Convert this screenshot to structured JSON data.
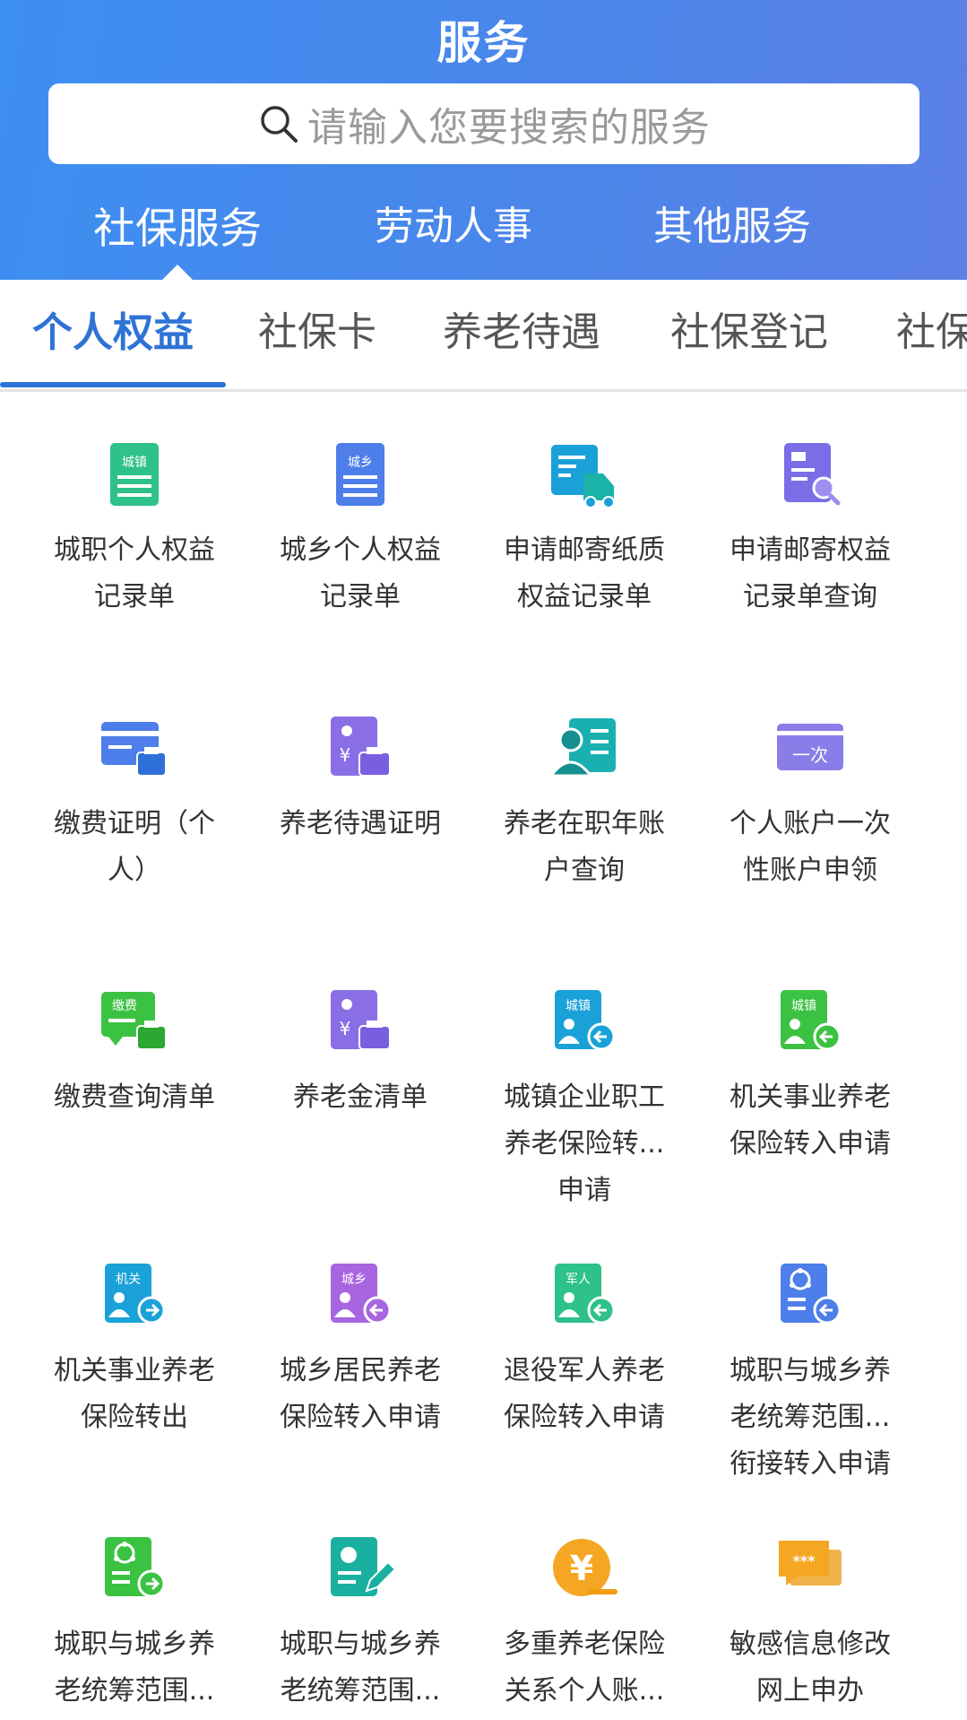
{
  "header": {
    "title": "服务",
    "search": {
      "placeholder": "请输入您要搜索的服务"
    },
    "main_tabs": [
      {
        "label": "社保服务",
        "active": true
      },
      {
        "label": "劳动人事",
        "active": false
      },
      {
        "label": "其他服务",
        "active": false
      }
    ]
  },
  "sub_tabs": [
    {
      "label": "个人权益",
      "active": true
    },
    {
      "label": "社保卡",
      "active": false
    },
    {
      "label": "养老待遇",
      "active": false
    },
    {
      "label": "社保登记",
      "active": false
    },
    {
      "label": "社保",
      "active": false
    }
  ],
  "colors": {
    "header_blue": "#4a86ea",
    "active_tab": "#2f73d6",
    "green": "#25b87a",
    "blue": "#4a7ee8",
    "teal": "#1aa2d8",
    "purple": "#7a6de6",
    "orange": "#f5a623"
  },
  "services": [
    {
      "label": "城职个人权益记录单",
      "icon": "city-record-icon",
      "icon_text": "城镇"
    },
    {
      "label": "城乡个人权益记录单",
      "icon": "rural-record-icon",
      "icon_text": "城乡"
    },
    {
      "label": "申请邮寄纸质权益记录单",
      "icon": "mail-truck-icon"
    },
    {
      "label": "申请邮寄权益记录单查询",
      "icon": "mail-search-icon"
    },
    {
      "label": "缴费证明（个人）",
      "icon": "payment-certificate-icon"
    },
    {
      "label": "养老待遇证明",
      "icon": "pension-certificate-icon",
      "icon_text": "¥"
    },
    {
      "label": "养老在职年账户查询",
      "icon": "account-person-icon"
    },
    {
      "label": "个人账户一次性账户申领",
      "icon": "one-time-card-icon",
      "icon_text": "一次"
    },
    {
      "label": "缴费查询清单",
      "icon": "payment-list-icon",
      "icon_text": "缴费"
    },
    {
      "label": "养老金清单",
      "icon": "pension-list-icon",
      "icon_text": "¥"
    },
    {
      "label": "城镇企业职工养老保险转...申请",
      "icon": "city-transfer-in-icon",
      "icon_text": "城镇"
    },
    {
      "label": "机关事业养老保险转入申请",
      "icon": "agency-transfer-in-icon",
      "icon_text": "城镇"
    },
    {
      "label": "机关事业养老保险转出",
      "icon": "agency-transfer-out-icon",
      "icon_text": "机关"
    },
    {
      "label": "城乡居民养老保险转入申请",
      "icon": "rural-transfer-in-icon",
      "icon_text": "城乡"
    },
    {
      "label": "退役军人养老保险转入申请",
      "icon": "veteran-transfer-in-icon",
      "icon_text": "军人"
    },
    {
      "label": "城职与城乡养老统筹范围...衔接转入申请",
      "icon": "coordination-transfer-in-icon"
    },
    {
      "label": "城职与城乡养老统筹范围...",
      "icon": "coordination-transfer-out-icon"
    },
    {
      "label": "城职与城乡养老统筹范围...",
      "icon": "coordination-edit-icon"
    },
    {
      "label": "多重养老保险关系个人账...",
      "icon": "yen-coin-icon",
      "icon_text": "¥"
    },
    {
      "label": "敏感信息修改网上申办",
      "icon": "chat-bubble-icon",
      "icon_text": "***"
    }
  ]
}
